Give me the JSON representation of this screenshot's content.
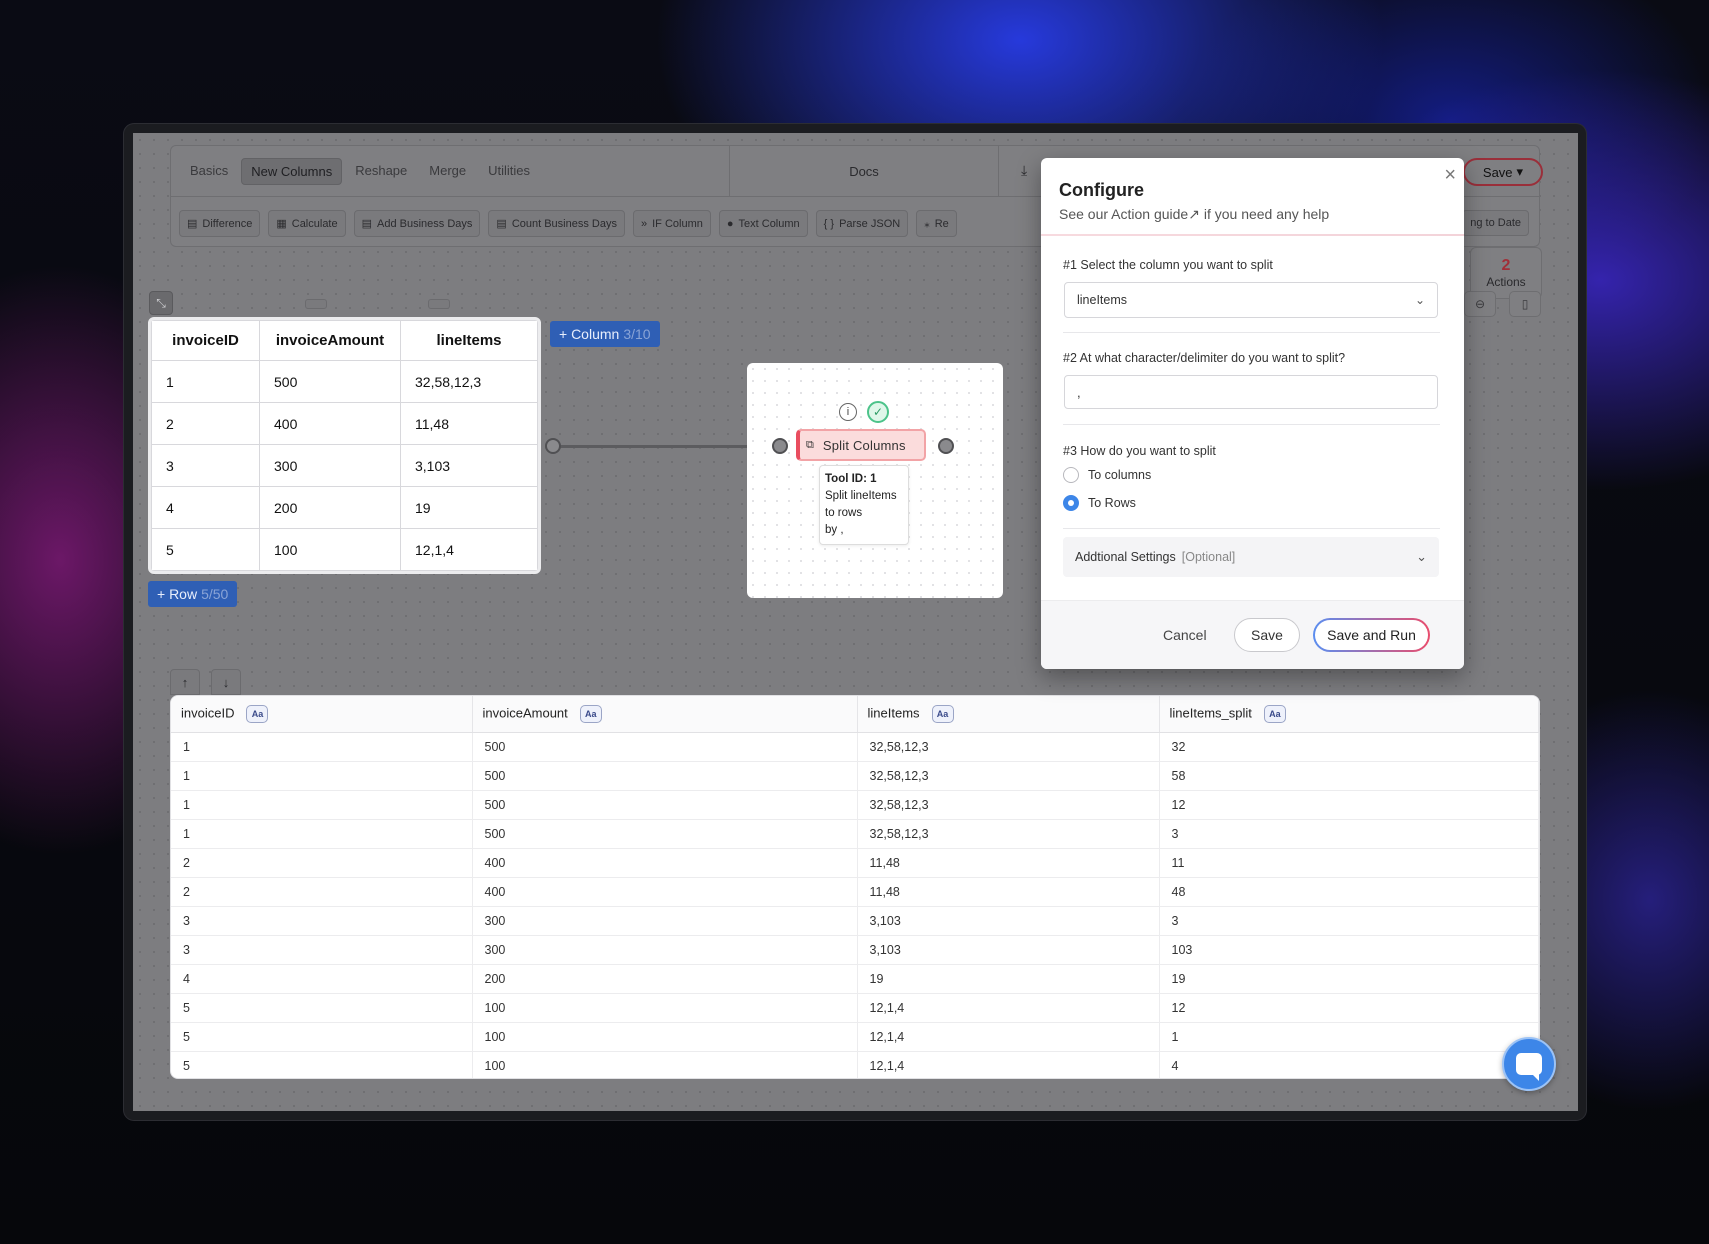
{
  "toolbar": {
    "tabs": [
      {
        "label": "Basics"
      },
      {
        "label": "New Columns"
      },
      {
        "label": "Reshape"
      },
      {
        "label": "Merge"
      },
      {
        "label": "Utilities"
      }
    ],
    "docs_label": "Docs",
    "save_label": "Save",
    "actions": [
      {
        "label": "Difference"
      },
      {
        "label": "Calculate"
      },
      {
        "label": "Add Business Days"
      },
      {
        "label": "Count Business Days"
      },
      {
        "label": "IF Column"
      },
      {
        "label": "Text Column"
      },
      {
        "label": "Parse JSON"
      },
      {
        "label": "Re"
      }
    ],
    "action_right_label": "ng to Date"
  },
  "actions_counter": {
    "count": "2",
    "label": "Actions"
  },
  "source_table": {
    "headers": [
      "invoiceID",
      "invoiceAmount",
      "lineItems"
    ],
    "rows": [
      [
        "1",
        "500",
        "32,58,12,3"
      ],
      [
        "2",
        "400",
        "11,48"
      ],
      [
        "3",
        "300",
        "3,103"
      ],
      [
        "4",
        "200",
        "19"
      ],
      [
        "5",
        "100",
        "12,1,4"
      ]
    ],
    "add_column": {
      "label": "+ Column",
      "count": "3/10"
    },
    "add_row": {
      "label": "+ Row",
      "count": "5/50"
    }
  },
  "node": {
    "title": "Split Columns",
    "tooltip_id": "Tool ID: 1",
    "tooltip_line1": "Split lineItems",
    "tooltip_line2": "to rows",
    "tooltip_line3": "by ,"
  },
  "results_table": {
    "type_badge": "Aa",
    "headers": [
      "invoiceID",
      "invoiceAmount",
      "lineItems",
      "lineItems_split"
    ],
    "rows": [
      [
        "1",
        "500",
        "32,58,12,3",
        "32"
      ],
      [
        "1",
        "500",
        "32,58,12,3",
        "58"
      ],
      [
        "1",
        "500",
        "32,58,12,3",
        "12"
      ],
      [
        "1",
        "500",
        "32,58,12,3",
        "3"
      ],
      [
        "2",
        "400",
        "11,48",
        "11"
      ],
      [
        "2",
        "400",
        "11,48",
        "48"
      ],
      [
        "3",
        "300",
        "3,103",
        "3"
      ],
      [
        "3",
        "300",
        "3,103",
        "103"
      ],
      [
        "4",
        "200",
        "19",
        "19"
      ],
      [
        "5",
        "100",
        "12,1,4",
        "12"
      ],
      [
        "5",
        "100",
        "12,1,4",
        "1"
      ],
      [
        "5",
        "100",
        "12,1,4",
        "4"
      ]
    ]
  },
  "modal": {
    "title": "Configure",
    "subtitle_prefix": "See our ",
    "guide_link": "Action guide↗",
    "subtitle_suffix": " if you need any help",
    "q1_label": "#1 Select the column you want to split",
    "q1_value": "lineItems",
    "q2_label": "#2 At what character/delimiter do you want to split?",
    "q2_value": ",",
    "q3_label": "#3 How do you want to split",
    "radio_columns": "To columns",
    "radio_rows": "To Rows",
    "radio_selected": "To Rows",
    "additional_label": "Addtional Settings",
    "additional_optional": "[Optional]",
    "cancel_label": "Cancel",
    "save_label": "Save",
    "save_run_label": "Save and Run"
  }
}
